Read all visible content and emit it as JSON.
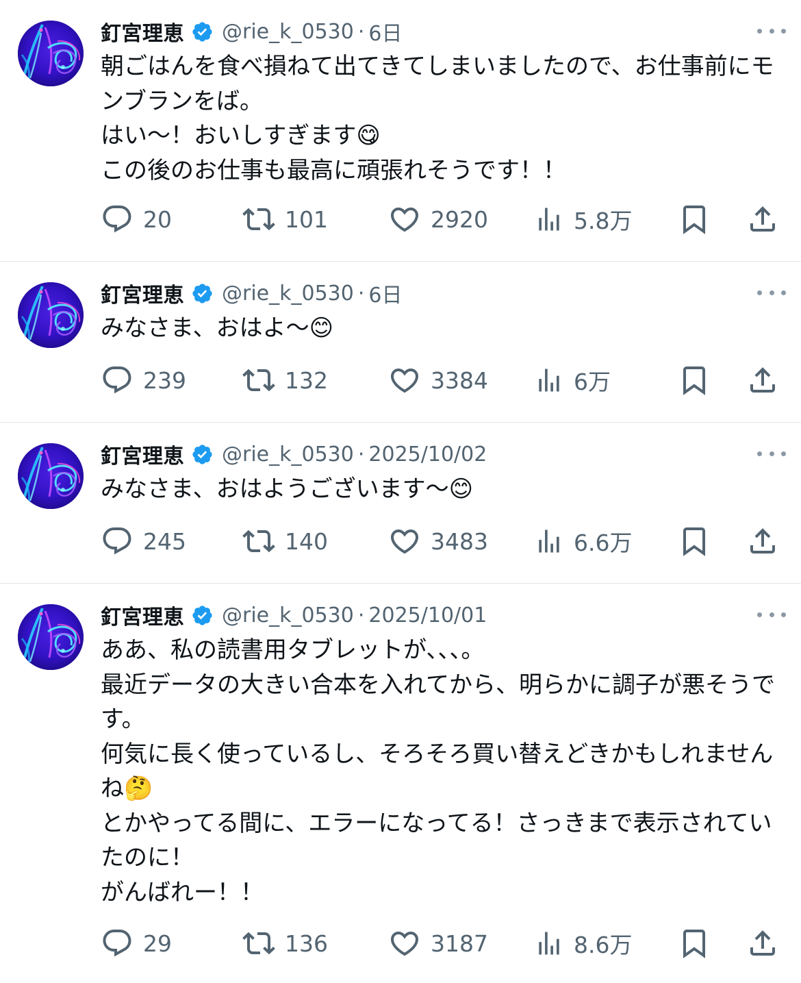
{
  "account": {
    "name": "釘宮理恵",
    "handle": "@rie_k_0530",
    "separator": "·"
  },
  "icons": {
    "avatar": "profile-avatar-neon-light",
    "verified": "verified-badge-icon",
    "more": "more-options-icon",
    "reply": "reply-bubble-icon",
    "retweet": "retweet-icon",
    "like": "heart-icon",
    "views": "views-bar-chart-icon",
    "bookmark": "bookmark-icon",
    "share": "share-icon"
  },
  "colors": {
    "text": "#0f1419",
    "secondary": "#536471",
    "verified": "#1d9bf0",
    "divider": "#e3e6e9"
  },
  "tweets": [
    {
      "time": "6日",
      "text": "朝ごはんを食べ損ねて出てきてしまいましたので、お仕事前にモンブランをば。\nはい〜！おいしすぎます😋\nこの後のお仕事も最高に頑張れそうです！！",
      "replies": "20",
      "retweets": "101",
      "likes": "2920",
      "views": "5.8万"
    },
    {
      "time": "6日",
      "text": "みなさま、おはよ〜😊",
      "replies": "239",
      "retweets": "132",
      "likes": "3384",
      "views": "6万"
    },
    {
      "time": "2025/10/02",
      "text": "みなさま、おはようございます〜😊",
      "replies": "245",
      "retweets": "140",
      "likes": "3483",
      "views": "6.6万"
    },
    {
      "time": "2025/10/01",
      "text": "ああ、私の読書用タブレットが、、、。\n最近データの大きい合本を入れてから、明らかに調子が悪そうです。\n何気に長く使っているし、そろそろ買い替えどきかもしれませんね🤔\nとかやってる間に、エラーになってる！さっきまで表示されていたのに！\nがんばれー！！",
      "replies": "29",
      "retweets": "136",
      "likes": "3187",
      "views": "8.6万"
    }
  ]
}
